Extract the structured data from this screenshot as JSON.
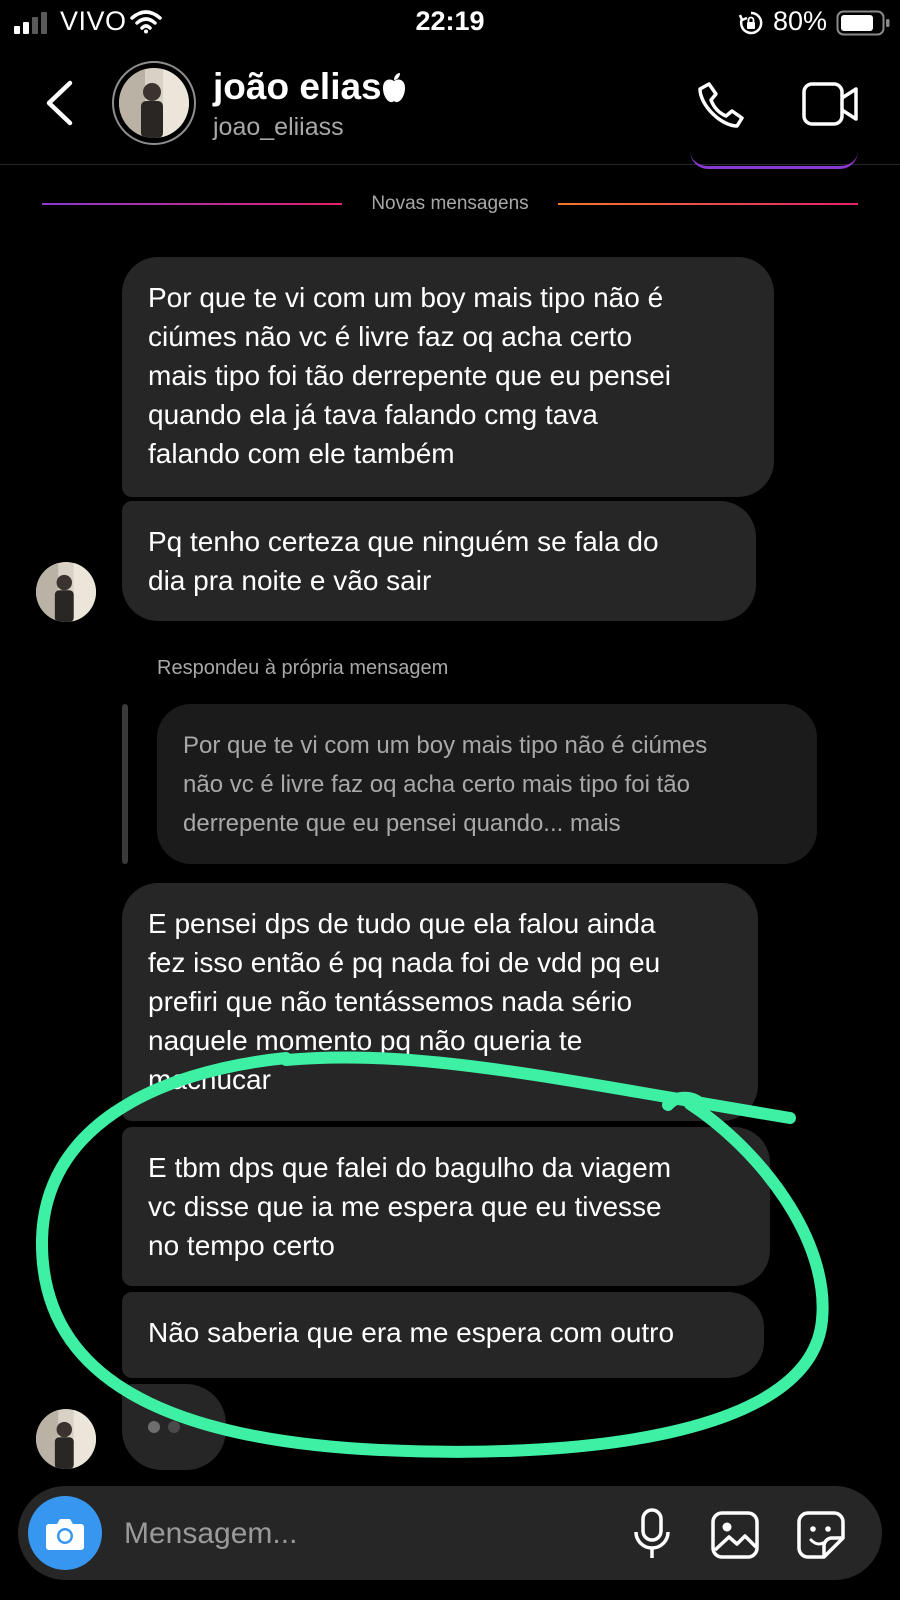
{
  "status_bar": {
    "carrier": "VIVO",
    "time": "22:19",
    "battery": "80%"
  },
  "header": {
    "name": "joão elias",
    "handle": "joao_eliiass"
  },
  "divider": {
    "label": "Novas mensagens"
  },
  "messages": [
    {
      "text": "Por que te vi com um boy mais tipo não é\nciúmes não vc é livre faz oq acha certo\nmais tipo foi tão derrepente que eu pensei\nquando ela já tava falando cmg tava\nfalando com ele também"
    },
    {
      "text": "Pq tenho certeza que ninguém se fala do\ndia pra noite e vão sair"
    },
    {
      "text": "E pensei dps de tudo que ela falou ainda\nfez isso então é pq nada foi de vdd pq eu\nprefiri que não tentássemos nada sério\nnaquele momento pq não queria te\nmachucar"
    },
    {
      "text": "E tbm dps que falei do bagulho da viagem\nvc disse que ia me espera que eu tivesse\nno tempo certo"
    },
    {
      "text": "Não saberia que era me espera com outro"
    }
  ],
  "reply": {
    "label": "Respondeu à própria mensagem",
    "quote": "Por que te vi com um boy mais tipo não é ciúmes\nnão vc é livre faz oq acha certo mais tipo foi tão\nderrepente que eu pensei quando... mais"
  },
  "composer": {
    "placeholder": "Mensagem..."
  },
  "colors": {
    "background": "#000000",
    "bubble": "#262626",
    "accent_blue": "#3797f0",
    "annotation_green": "#3ef0a4"
  }
}
